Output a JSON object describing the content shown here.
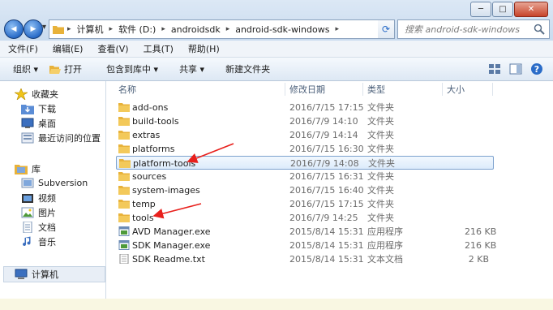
{
  "window": {
    "minimize": "─",
    "maximize": "□",
    "close": "✕"
  },
  "nav": {
    "back": "◀",
    "forward": "▶",
    "dropdown": "▾"
  },
  "address": {
    "crumbs": [
      "计算机",
      "软件 (D:)",
      "androidsdk",
      "android-sdk-windows"
    ],
    "refresh": "⟳"
  },
  "search": {
    "placeholder": "搜索 android-sdk-windows"
  },
  "menubar": [
    "文件(F)",
    "编辑(E)",
    "查看(V)",
    "工具(T)",
    "帮助(H)"
  ],
  "toolbar": {
    "organize": "组织 ▾",
    "open": "打开",
    "include_library": "包含到库中 ▾",
    "share": "共享 ▾",
    "new_folder": "新建文件夹"
  },
  "sidebar": {
    "favorites": {
      "label": "收藏夹",
      "items": [
        "下载",
        "桌面",
        "最近访问的位置"
      ]
    },
    "libraries": {
      "label": "库",
      "items": [
        "Subversion",
        "视频",
        "图片",
        "文档",
        "音乐"
      ]
    },
    "computer": "计算机"
  },
  "columns": {
    "name": "名称",
    "date": "修改日期",
    "type": "类型",
    "size": "大小"
  },
  "files": [
    {
      "name": "add-ons",
      "date": "2016/7/15 17:15",
      "type": "文件夹",
      "size": "",
      "kind": "folder"
    },
    {
      "name": "build-tools",
      "date": "2016/7/9 14:10",
      "type": "文件夹",
      "size": "",
      "kind": "folder"
    },
    {
      "name": "extras",
      "date": "2016/7/9 14:14",
      "type": "文件夹",
      "size": "",
      "kind": "folder"
    },
    {
      "name": "platforms",
      "date": "2016/7/15 16:30",
      "type": "文件夹",
      "size": "",
      "kind": "folder"
    },
    {
      "name": "platform-tools",
      "date": "2016/7/9 14:08",
      "type": "文件夹",
      "size": "",
      "kind": "folder"
    },
    {
      "name": "sources",
      "date": "2016/7/15 16:31",
      "type": "文件夹",
      "size": "",
      "kind": "folder"
    },
    {
      "name": "system-images",
      "date": "2016/7/15 16:40",
      "type": "文件夹",
      "size": "",
      "kind": "folder"
    },
    {
      "name": "temp",
      "date": "2016/7/15 17:15",
      "type": "文件夹",
      "size": "",
      "kind": "folder"
    },
    {
      "name": "tools",
      "date": "2016/7/9 14:25",
      "type": "文件夹",
      "size": "",
      "kind": "folder"
    },
    {
      "name": "AVD Manager.exe",
      "date": "2015/8/14 15:31",
      "type": "应用程序",
      "size": "216 KB",
      "kind": "exe"
    },
    {
      "name": "SDK Manager.exe",
      "date": "2015/8/14 15:31",
      "type": "应用程序",
      "size": "216 KB",
      "kind": "exe"
    },
    {
      "name": "SDK Readme.txt",
      "date": "2015/8/14 15:31",
      "type": "文本文档",
      "size": "2 KB",
      "kind": "txt"
    }
  ],
  "colors": {
    "folder": "#e8b23a",
    "accent": "#2a6cc8",
    "arrow": "#e8201c",
    "selection_border": "#7da2ce"
  }
}
